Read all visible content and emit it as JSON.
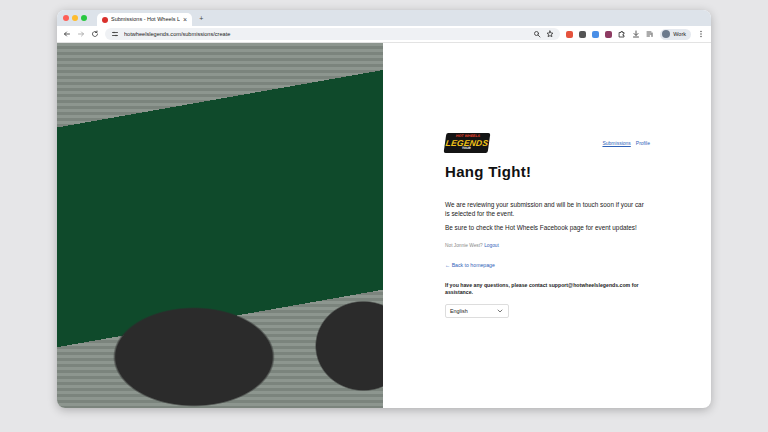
{
  "browser": {
    "tab": {
      "title": "Submissions - Hot Wheels L",
      "close": "×",
      "selected": true
    },
    "new_tab": "+",
    "url": "hotwheelslegends.com/submissions/create",
    "profile": "Work"
  },
  "logo": {
    "top": "HOT WHEELS",
    "main": "LEGENDS",
    "sub": "TOUR"
  },
  "nav": [
    {
      "label": "Submissions",
      "selected": true
    },
    {
      "label": "Profile",
      "selected": false
    }
  ],
  "heading": "Hang Tight!",
  "paragraphs": [
    "We are reviewing your submission and will be in touch soon if your car is selected for the event.",
    "Be sure to check the Hot Wheels Facebook page for event updates!"
  ],
  "account": {
    "prompt": "Not Jonnie West?",
    "action": "Logout"
  },
  "back_link": "← Back to homepage",
  "contact": "If you have any questions, please contact support@hotwheelslegends.com for assistance.",
  "language": {
    "value": "English"
  }
}
